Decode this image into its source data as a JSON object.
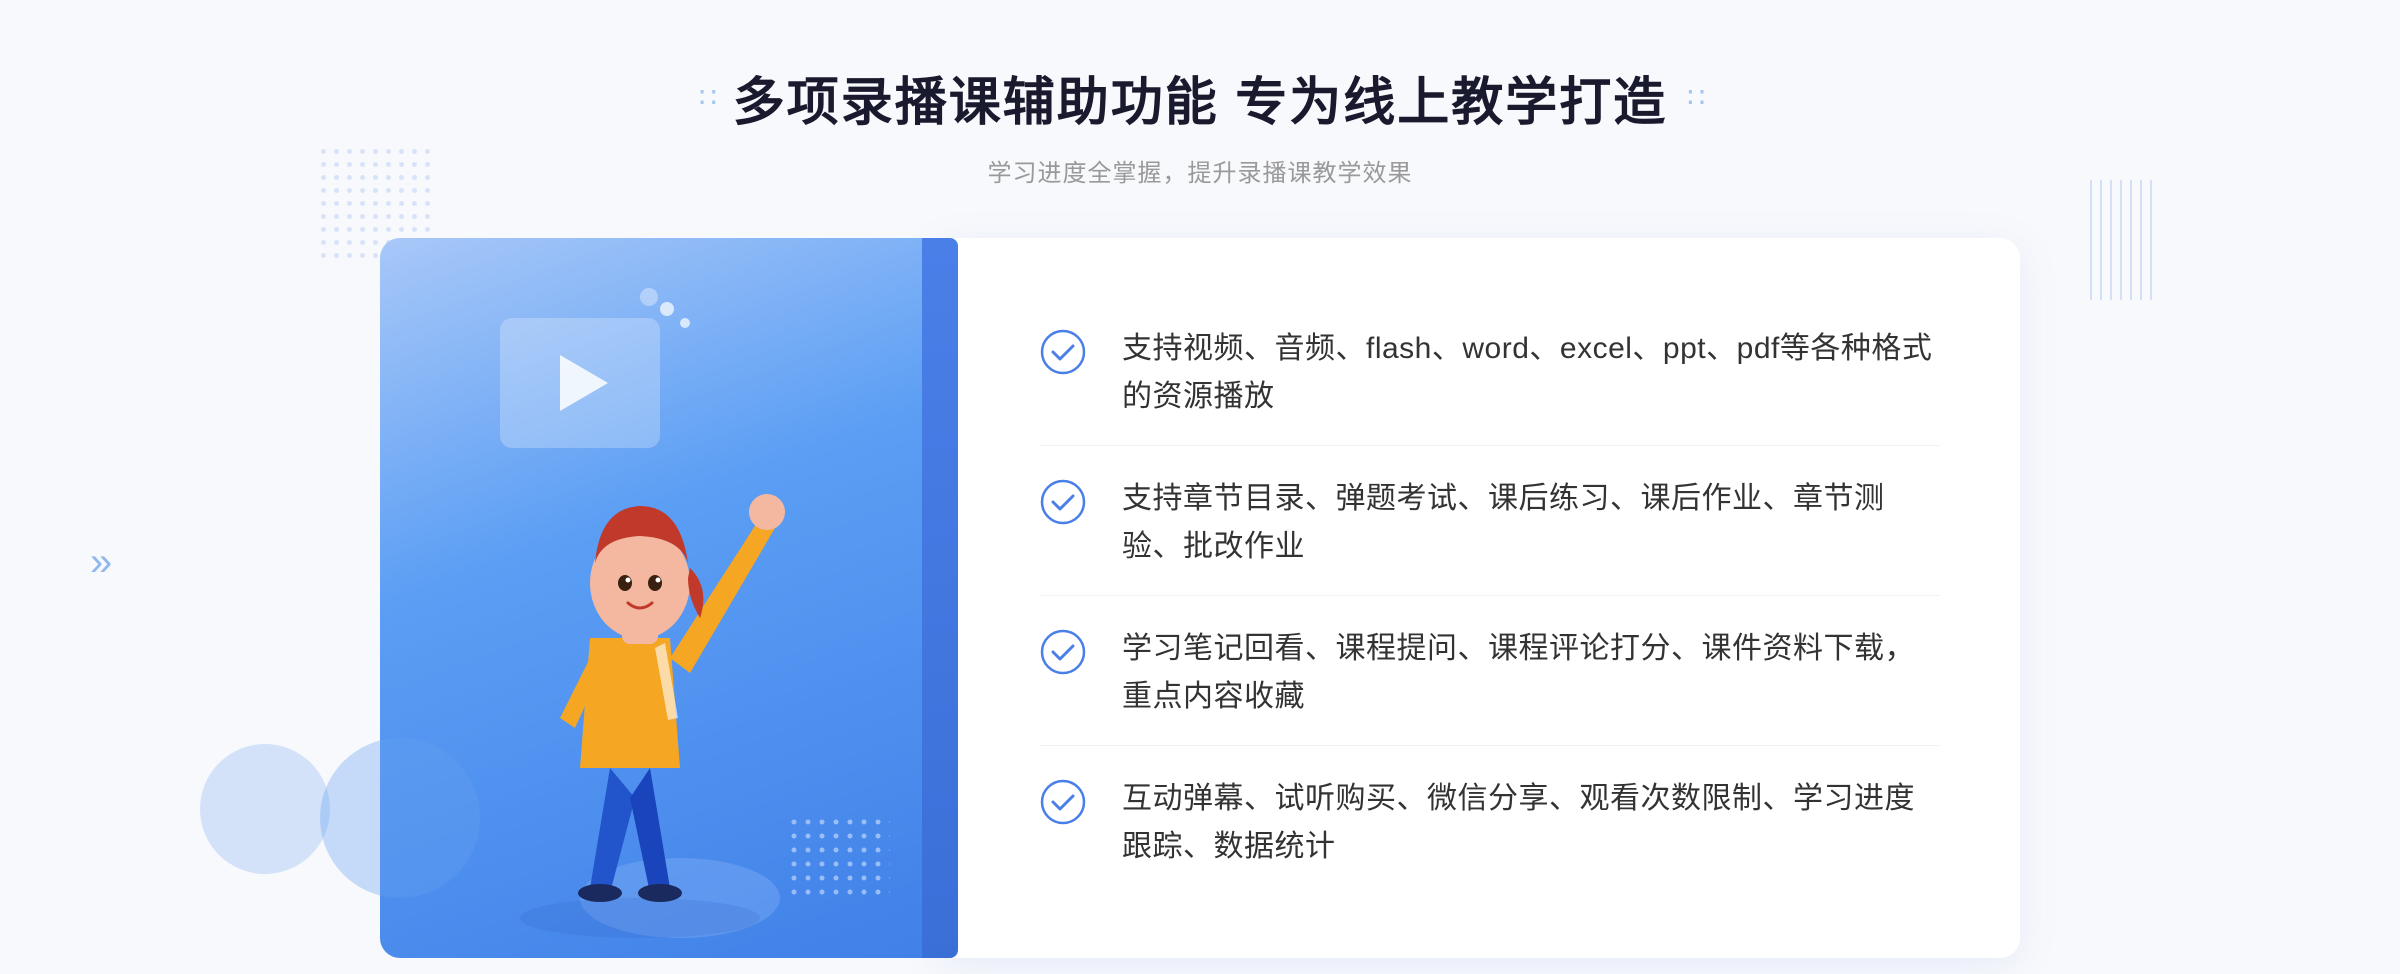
{
  "header": {
    "title": "多项录播课辅助功能 专为线上教学打造",
    "subtitle": "学习进度全掌握，提升录播课教学效果",
    "deco_left": "∷",
    "deco_right": "∷"
  },
  "features": [
    {
      "id": "feature-1",
      "text": "支持视频、音频、flash、word、excel、ppt、pdf等各种格式的资源播放"
    },
    {
      "id": "feature-2",
      "text": "支持章节目录、弹题考试、课后练习、课后作业、章节测验、批改作业"
    },
    {
      "id": "feature-3",
      "text": "学习笔记回看、课程提问、课程评论打分、课件资料下载，重点内容收藏"
    },
    {
      "id": "feature-4",
      "text": "互动弹幕、试听购买、微信分享、观看次数限制、学习进度跟踪、数据统计"
    }
  ],
  "colors": {
    "primary": "#4a7fe8",
    "accent": "#5b9ef4",
    "text_dark": "#1a1a2e",
    "text_gray": "#999999",
    "text_feature": "#333333",
    "bg": "#f8f9fc",
    "card_bg": "#ffffff"
  },
  "illustration": {
    "play_label": "play-button"
  }
}
